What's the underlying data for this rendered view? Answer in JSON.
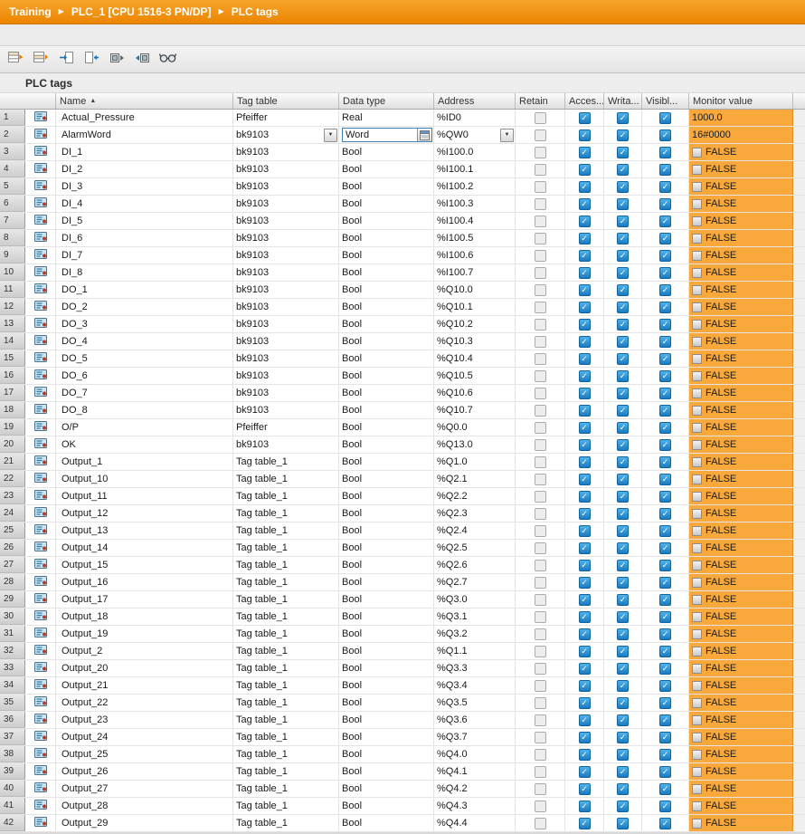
{
  "breadcrumb": {
    "items": [
      "Training",
      "PLC_1 [CPU 1516-3 PN/DP]",
      "PLC tags"
    ],
    "separator": "▶"
  },
  "toolbar": {
    "buttons": [
      {
        "icon": "insert-row-icon"
      },
      {
        "icon": "add-row-icon"
      },
      {
        "icon": "export-icon"
      },
      {
        "icon": "import-icon"
      },
      {
        "icon": "snapshot-icon"
      },
      {
        "icon": "apply-snapshot-icon"
      },
      {
        "icon": "monitor-all-icon"
      }
    ]
  },
  "section": {
    "title": "PLC tags"
  },
  "colors": {
    "breadcrumb_orange": "#EC8500",
    "monitor_orange": "#F9A93B",
    "checkbox_blue": "#1B7AC2"
  },
  "table": {
    "headers": {
      "name": "Name",
      "tag_table": "Tag table",
      "data_type": "Data type",
      "address": "Address",
      "retain": "Retain",
      "access": "Acces...",
      "write": "Writa...",
      "visible": "Visibl...",
      "monitor": "Monitor value"
    },
    "sort_indicator": "▲",
    "rows": [
      {
        "num": 1,
        "name": "Actual_Pressure",
        "tag_table": "Pfeiffer",
        "data_type": "Real",
        "address": "%ID0",
        "retain": false,
        "access": true,
        "write": true,
        "visible": true,
        "monitor": "1000.0",
        "monitor_bool": false,
        "editing": false
      },
      {
        "num": 2,
        "name": "AlarmWord",
        "tag_table": "bk9103",
        "data_type": "Word",
        "address": "%QW0",
        "retain": false,
        "access": true,
        "write": true,
        "visible": true,
        "monitor": "16#0000",
        "monitor_bool": false,
        "editing": true
      },
      {
        "num": 3,
        "name": "DI_1",
        "tag_table": "bk9103",
        "data_type": "Bool",
        "address": "%I100.0",
        "retain": false,
        "access": true,
        "write": true,
        "visible": true,
        "monitor": "FALSE",
        "monitor_bool": true,
        "editing": false
      },
      {
        "num": 4,
        "name": "DI_2",
        "tag_table": "bk9103",
        "data_type": "Bool",
        "address": "%I100.1",
        "retain": false,
        "access": true,
        "write": true,
        "visible": true,
        "monitor": "FALSE",
        "monitor_bool": true,
        "editing": false
      },
      {
        "num": 5,
        "name": "DI_3",
        "tag_table": "bk9103",
        "data_type": "Bool",
        "address": "%I100.2",
        "retain": false,
        "access": true,
        "write": true,
        "visible": true,
        "monitor": "FALSE",
        "monitor_bool": true,
        "editing": false
      },
      {
        "num": 6,
        "name": "DI_4",
        "tag_table": "bk9103",
        "data_type": "Bool",
        "address": "%I100.3",
        "retain": false,
        "access": true,
        "write": true,
        "visible": true,
        "monitor": "FALSE",
        "monitor_bool": true,
        "editing": false
      },
      {
        "num": 7,
        "name": "DI_5",
        "tag_table": "bk9103",
        "data_type": "Bool",
        "address": "%I100.4",
        "retain": false,
        "access": true,
        "write": true,
        "visible": true,
        "monitor": "FALSE",
        "monitor_bool": true,
        "editing": false
      },
      {
        "num": 8,
        "name": "DI_6",
        "tag_table": "bk9103",
        "data_type": "Bool",
        "address": "%I100.5",
        "retain": false,
        "access": true,
        "write": true,
        "visible": true,
        "monitor": "FALSE",
        "monitor_bool": true,
        "editing": false
      },
      {
        "num": 9,
        "name": "DI_7",
        "tag_table": "bk9103",
        "data_type": "Bool",
        "address": "%I100.6",
        "retain": false,
        "access": true,
        "write": true,
        "visible": true,
        "monitor": "FALSE",
        "monitor_bool": true,
        "editing": false
      },
      {
        "num": 10,
        "name": "DI_8",
        "tag_table": "bk9103",
        "data_type": "Bool",
        "address": "%I100.7",
        "retain": false,
        "access": true,
        "write": true,
        "visible": true,
        "monitor": "FALSE",
        "monitor_bool": true,
        "editing": false
      },
      {
        "num": 11,
        "name": "DO_1",
        "tag_table": "bk9103",
        "data_type": "Bool",
        "address": "%Q10.0",
        "retain": false,
        "access": true,
        "write": true,
        "visible": true,
        "monitor": "FALSE",
        "monitor_bool": true,
        "editing": false
      },
      {
        "num": 12,
        "name": "DO_2",
        "tag_table": "bk9103",
        "data_type": "Bool",
        "address": "%Q10.1",
        "retain": false,
        "access": true,
        "write": true,
        "visible": true,
        "monitor": "FALSE",
        "monitor_bool": true,
        "editing": false
      },
      {
        "num": 13,
        "name": "DO_3",
        "tag_table": "bk9103",
        "data_type": "Bool",
        "address": "%Q10.2",
        "retain": false,
        "access": true,
        "write": true,
        "visible": true,
        "monitor": "FALSE",
        "monitor_bool": true,
        "editing": false
      },
      {
        "num": 14,
        "name": "DO_4",
        "tag_table": "bk9103",
        "data_type": "Bool",
        "address": "%Q10.3",
        "retain": false,
        "access": true,
        "write": true,
        "visible": true,
        "monitor": "FALSE",
        "monitor_bool": true,
        "editing": false
      },
      {
        "num": 15,
        "name": "DO_5",
        "tag_table": "bk9103",
        "data_type": "Bool",
        "address": "%Q10.4",
        "retain": false,
        "access": true,
        "write": true,
        "visible": true,
        "monitor": "FALSE",
        "monitor_bool": true,
        "editing": false
      },
      {
        "num": 16,
        "name": "DO_6",
        "tag_table": "bk9103",
        "data_type": "Bool",
        "address": "%Q10.5",
        "retain": false,
        "access": true,
        "write": true,
        "visible": true,
        "monitor": "FALSE",
        "monitor_bool": true,
        "editing": false
      },
      {
        "num": 17,
        "name": "DO_7",
        "tag_table": "bk9103",
        "data_type": "Bool",
        "address": "%Q10.6",
        "retain": false,
        "access": true,
        "write": true,
        "visible": true,
        "monitor": "FALSE",
        "monitor_bool": true,
        "editing": false
      },
      {
        "num": 18,
        "name": "DO_8",
        "tag_table": "bk9103",
        "data_type": "Bool",
        "address": "%Q10.7",
        "retain": false,
        "access": true,
        "write": true,
        "visible": true,
        "monitor": "FALSE",
        "monitor_bool": true,
        "editing": false
      },
      {
        "num": 19,
        "name": "O/P",
        "tag_table": "Pfeiffer",
        "data_type": "Bool",
        "address": "%Q0.0",
        "retain": false,
        "access": true,
        "write": true,
        "visible": true,
        "monitor": "FALSE",
        "monitor_bool": true,
        "editing": false
      },
      {
        "num": 20,
        "name": "OK",
        "tag_table": "bk9103",
        "data_type": "Bool",
        "address": "%Q13.0",
        "retain": false,
        "access": true,
        "write": true,
        "visible": true,
        "monitor": "FALSE",
        "monitor_bool": true,
        "editing": false
      },
      {
        "num": 21,
        "name": "Output_1",
        "tag_table": "Tag table_1",
        "data_type": "Bool",
        "address": "%Q1.0",
        "retain": false,
        "access": true,
        "write": true,
        "visible": true,
        "monitor": "FALSE",
        "monitor_bool": true,
        "editing": false
      },
      {
        "num": 22,
        "name": "Output_10",
        "tag_table": "Tag table_1",
        "data_type": "Bool",
        "address": "%Q2.1",
        "retain": false,
        "access": true,
        "write": true,
        "visible": true,
        "monitor": "FALSE",
        "monitor_bool": true,
        "editing": false
      },
      {
        "num": 23,
        "name": "Output_11",
        "tag_table": "Tag table_1",
        "data_type": "Bool",
        "address": "%Q2.2",
        "retain": false,
        "access": true,
        "write": true,
        "visible": true,
        "monitor": "FALSE",
        "monitor_bool": true,
        "editing": false
      },
      {
        "num": 24,
        "name": "Output_12",
        "tag_table": "Tag table_1",
        "data_type": "Bool",
        "address": "%Q2.3",
        "retain": false,
        "access": true,
        "write": true,
        "visible": true,
        "monitor": "FALSE",
        "monitor_bool": true,
        "editing": false
      },
      {
        "num": 25,
        "name": "Output_13",
        "tag_table": "Tag table_1",
        "data_type": "Bool",
        "address": "%Q2.4",
        "retain": false,
        "access": true,
        "write": true,
        "visible": true,
        "monitor": "FALSE",
        "monitor_bool": true,
        "editing": false
      },
      {
        "num": 26,
        "name": "Output_14",
        "tag_table": "Tag table_1",
        "data_type": "Bool",
        "address": "%Q2.5",
        "retain": false,
        "access": true,
        "write": true,
        "visible": true,
        "monitor": "FALSE",
        "monitor_bool": true,
        "editing": false
      },
      {
        "num": 27,
        "name": "Output_15",
        "tag_table": "Tag table_1",
        "data_type": "Bool",
        "address": "%Q2.6",
        "retain": false,
        "access": true,
        "write": true,
        "visible": true,
        "monitor": "FALSE",
        "monitor_bool": true,
        "editing": false
      },
      {
        "num": 28,
        "name": "Output_16",
        "tag_table": "Tag table_1",
        "data_type": "Bool",
        "address": "%Q2.7",
        "retain": false,
        "access": true,
        "write": true,
        "visible": true,
        "monitor": "FALSE",
        "monitor_bool": true,
        "editing": false
      },
      {
        "num": 29,
        "name": "Output_17",
        "tag_table": "Tag table_1",
        "data_type": "Bool",
        "address": "%Q3.0",
        "retain": false,
        "access": true,
        "write": true,
        "visible": true,
        "monitor": "FALSE",
        "monitor_bool": true,
        "editing": false
      },
      {
        "num": 30,
        "name": "Output_18",
        "tag_table": "Tag table_1",
        "data_type": "Bool",
        "address": "%Q3.1",
        "retain": false,
        "access": true,
        "write": true,
        "visible": true,
        "monitor": "FALSE",
        "monitor_bool": true,
        "editing": false
      },
      {
        "num": 31,
        "name": "Output_19",
        "tag_table": "Tag table_1",
        "data_type": "Bool",
        "address": "%Q3.2",
        "retain": false,
        "access": true,
        "write": true,
        "visible": true,
        "monitor": "FALSE",
        "monitor_bool": true,
        "editing": false
      },
      {
        "num": 32,
        "name": "Output_2",
        "tag_table": "Tag table_1",
        "data_type": "Bool",
        "address": "%Q1.1",
        "retain": false,
        "access": true,
        "write": true,
        "visible": true,
        "monitor": "FALSE",
        "monitor_bool": true,
        "editing": false
      },
      {
        "num": 33,
        "name": "Output_20",
        "tag_table": "Tag table_1",
        "data_type": "Bool",
        "address": "%Q3.3",
        "retain": false,
        "access": true,
        "write": true,
        "visible": true,
        "monitor": "FALSE",
        "monitor_bool": true,
        "editing": false
      },
      {
        "num": 34,
        "name": "Output_21",
        "tag_table": "Tag table_1",
        "data_type": "Bool",
        "address": "%Q3.4",
        "retain": false,
        "access": true,
        "write": true,
        "visible": true,
        "monitor": "FALSE",
        "monitor_bool": true,
        "editing": false
      },
      {
        "num": 35,
        "name": "Output_22",
        "tag_table": "Tag table_1",
        "data_type": "Bool",
        "address": "%Q3.5",
        "retain": false,
        "access": true,
        "write": true,
        "visible": true,
        "monitor": "FALSE",
        "monitor_bool": true,
        "editing": false
      },
      {
        "num": 36,
        "name": "Output_23",
        "tag_table": "Tag table_1",
        "data_type": "Bool",
        "address": "%Q3.6",
        "retain": false,
        "access": true,
        "write": true,
        "visible": true,
        "monitor": "FALSE",
        "monitor_bool": true,
        "editing": false
      },
      {
        "num": 37,
        "name": "Output_24",
        "tag_table": "Tag table_1",
        "data_type": "Bool",
        "address": "%Q3.7",
        "retain": false,
        "access": true,
        "write": true,
        "visible": true,
        "monitor": "FALSE",
        "monitor_bool": true,
        "editing": false
      },
      {
        "num": 38,
        "name": "Output_25",
        "tag_table": "Tag table_1",
        "data_type": "Bool",
        "address": "%Q4.0",
        "retain": false,
        "access": true,
        "write": true,
        "visible": true,
        "monitor": "FALSE",
        "monitor_bool": true,
        "editing": false
      },
      {
        "num": 39,
        "name": "Output_26",
        "tag_table": "Tag table_1",
        "data_type": "Bool",
        "address": "%Q4.1",
        "retain": false,
        "access": true,
        "write": true,
        "visible": true,
        "monitor": "FALSE",
        "monitor_bool": true,
        "editing": false
      },
      {
        "num": 40,
        "name": "Output_27",
        "tag_table": "Tag table_1",
        "data_type": "Bool",
        "address": "%Q4.2",
        "retain": false,
        "access": true,
        "write": true,
        "visible": true,
        "monitor": "FALSE",
        "monitor_bool": true,
        "editing": false
      },
      {
        "num": 41,
        "name": "Output_28",
        "tag_table": "Tag table_1",
        "data_type": "Bool",
        "address": "%Q4.3",
        "retain": false,
        "access": true,
        "write": true,
        "visible": true,
        "monitor": "FALSE",
        "monitor_bool": true,
        "editing": false
      },
      {
        "num": 42,
        "name": "Output_29",
        "tag_table": "Tag table_1",
        "data_type": "Bool",
        "address": "%Q4.4",
        "retain": false,
        "access": true,
        "write": true,
        "visible": true,
        "monitor": "FALSE",
        "monitor_bool": true,
        "editing": false
      }
    ]
  }
}
